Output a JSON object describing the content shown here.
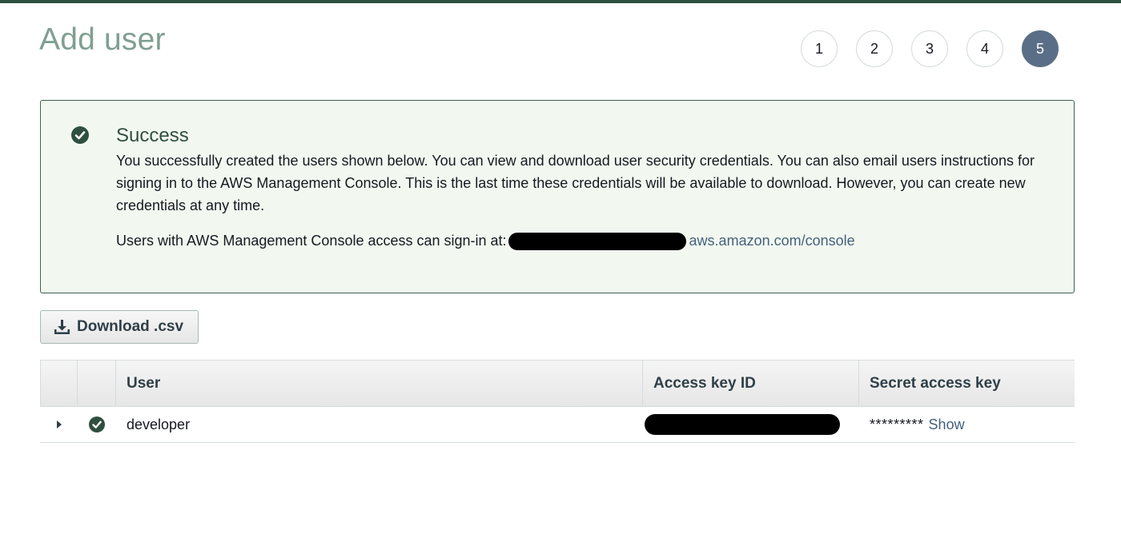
{
  "page": {
    "title": "Add user"
  },
  "steps": [
    {
      "label": "1",
      "active": false
    },
    {
      "label": "2",
      "active": false
    },
    {
      "label": "3",
      "active": false
    },
    {
      "label": "4",
      "active": false
    },
    {
      "label": "5",
      "active": true
    }
  ],
  "alert": {
    "icon": "check-circle-icon",
    "title": "Success",
    "message": "You successfully created the users shown below. You can view and download user security credentials. You can also email users instructions for signing in to the AWS Management Console. This is the last time these credentials will be available to download. However, you can create new credentials at any time.",
    "signin_prefix": "Users with AWS Management Console access can sign-in at:",
    "signin_link_suffix": "aws.amazon.com/console",
    "color_border": "#3e5e4f",
    "color_background": "#f2f8f0"
  },
  "download_button": {
    "icon": "download-icon",
    "label": "Download .csv"
  },
  "table": {
    "columns": [
      "",
      "",
      "User",
      "Access key ID",
      "Secret access key"
    ],
    "rows": [
      {
        "expand_icon": "caret-right-icon",
        "status_icon": "check-circle-icon",
        "user": "developer",
        "access_key_id": "",
        "secret_mask": "*********",
        "secret_action": "Show"
      }
    ]
  },
  "colors": {
    "accent": "#5a6f87",
    "link": "#44617e",
    "title": "#7f9f92"
  }
}
